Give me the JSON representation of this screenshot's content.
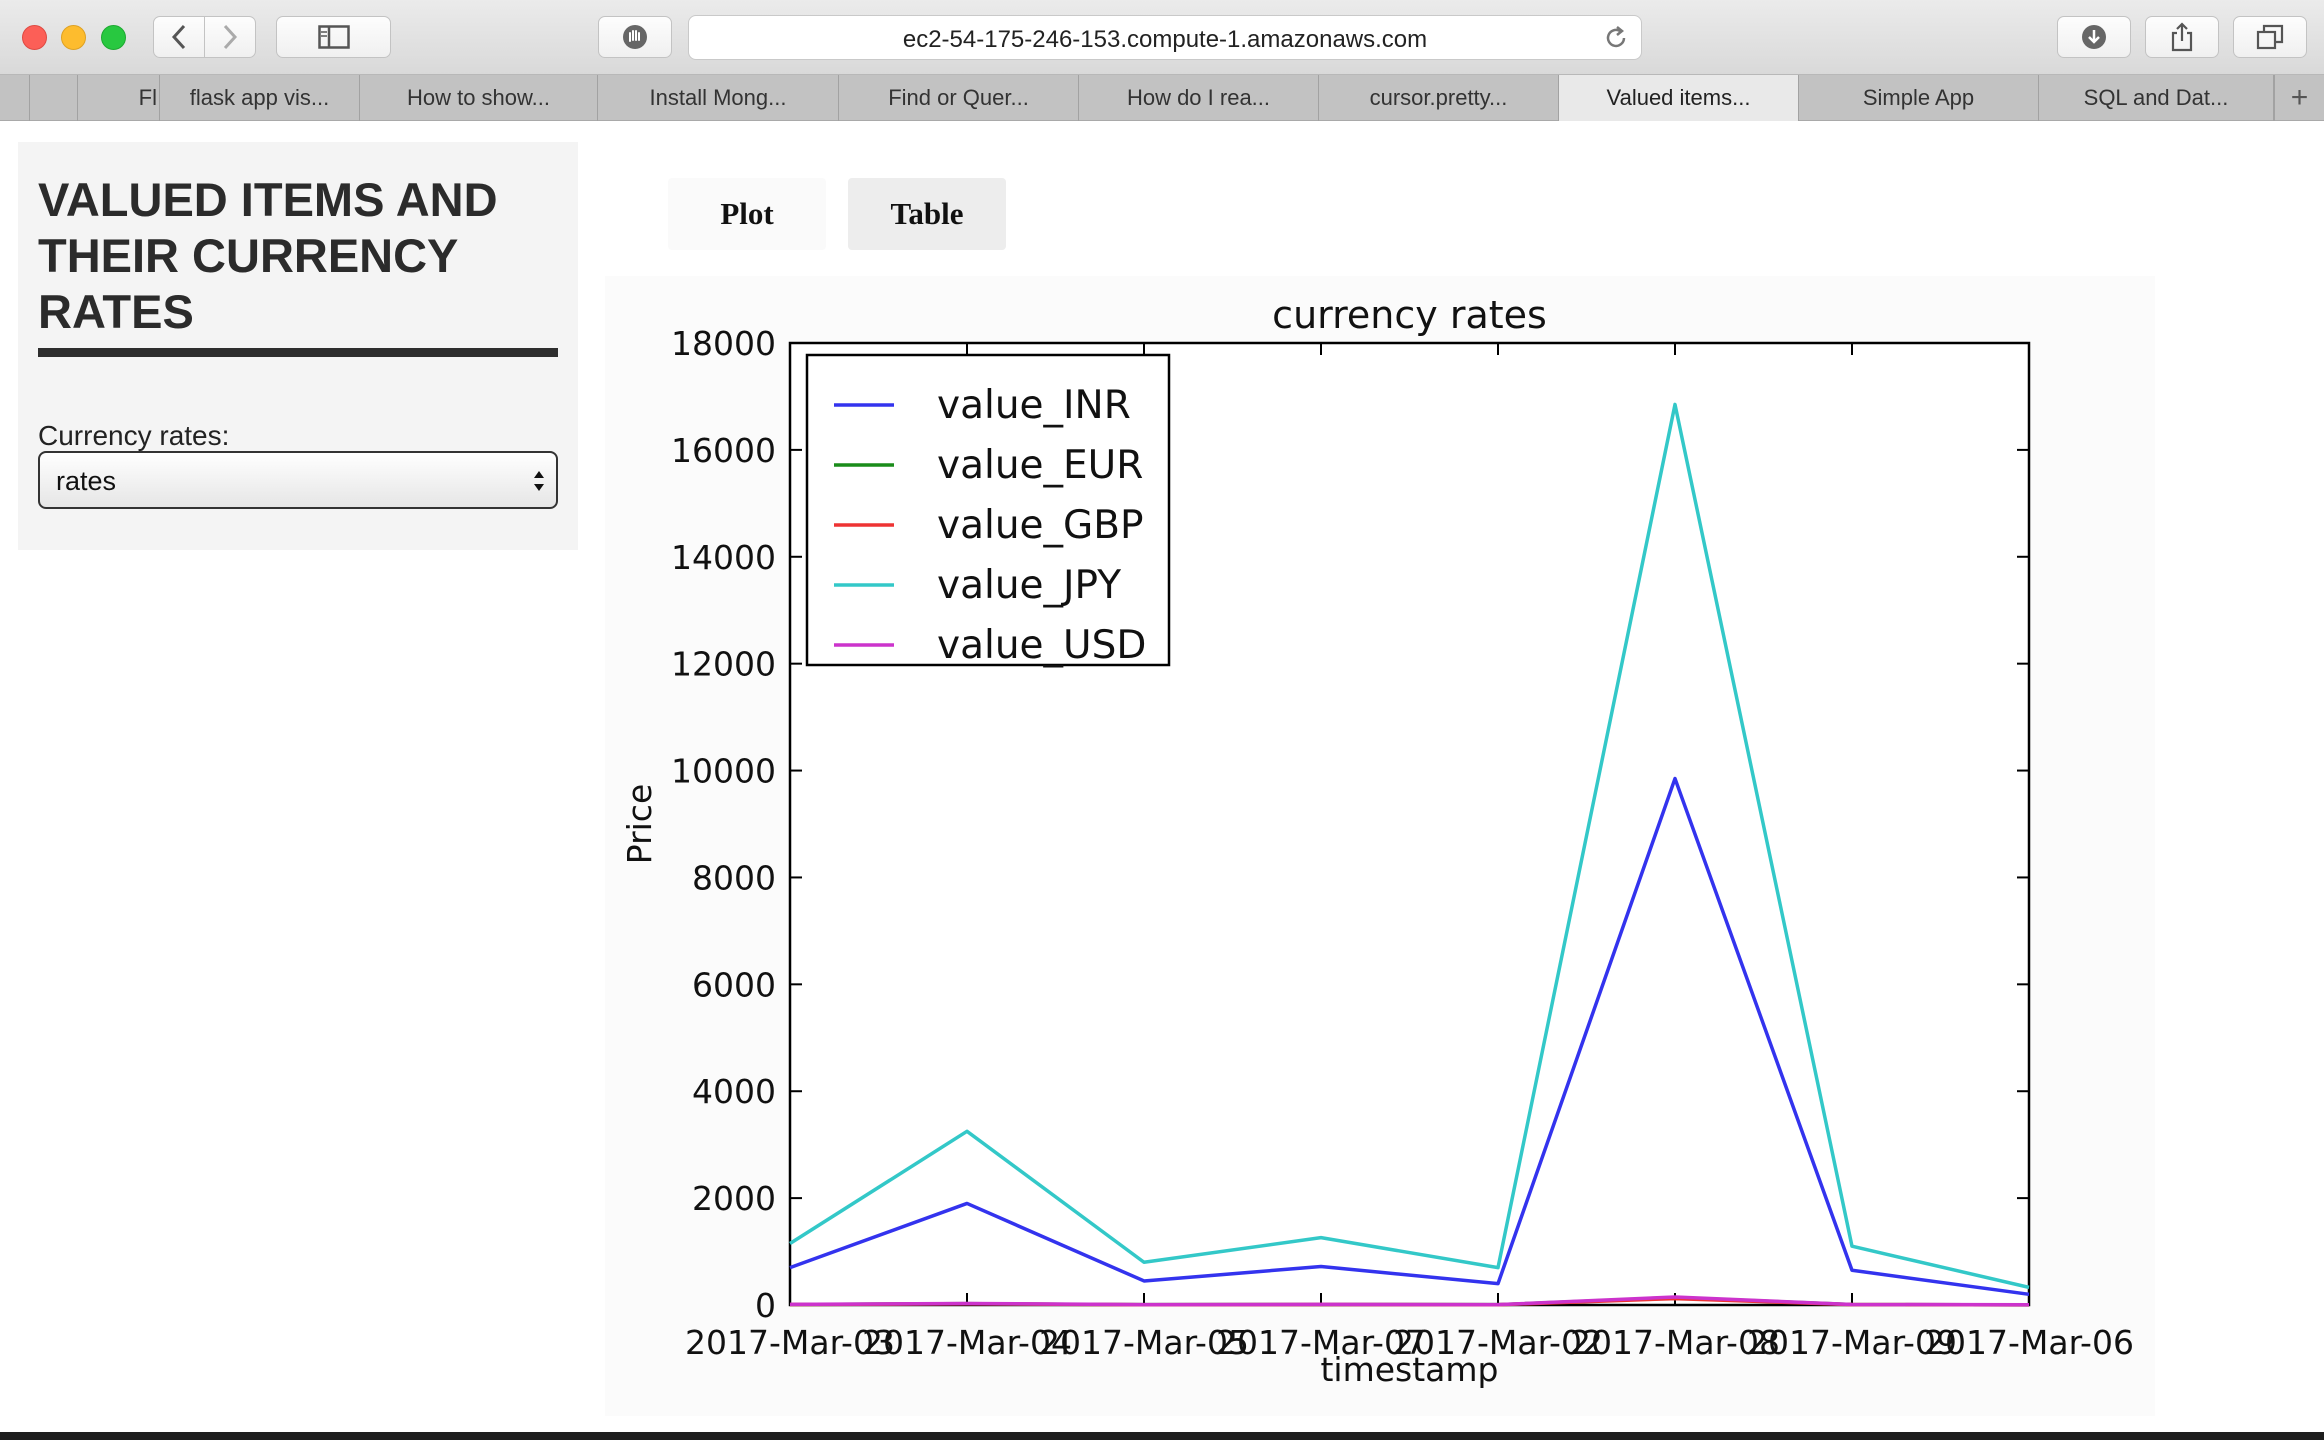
{
  "browser": {
    "url": "ec2-54-175-246-153.compute-1.amazonaws.com",
    "tabs": [
      {
        "label": "Fl"
      },
      {
        "label": "flask app vis..."
      },
      {
        "label": "How to show..."
      },
      {
        "label": "Install Mong..."
      },
      {
        "label": "Find or Quer..."
      },
      {
        "label": "How do I rea..."
      },
      {
        "label": "cursor.pretty..."
      },
      {
        "label": "Valued items..."
      },
      {
        "label": "Simple App"
      },
      {
        "label": "SQL and Dat..."
      }
    ],
    "active_tab_index": 7
  },
  "sidebar": {
    "title": "VALUED ITEMS AND THEIR CURRENCY RATES",
    "select_label": "Currency rates:",
    "select_value": "rates"
  },
  "view_tabs": {
    "plot": "Plot",
    "table": "Table"
  },
  "chart_data": {
    "type": "line",
    "title": "currency rates",
    "xlabel": "timestamp",
    "ylabel": "Price",
    "categories": [
      "2017-Mar-03",
      "2017-Mar-04",
      "2017-Mar-05",
      "2017-Mar-07",
      "2017-Mar-02",
      "2017-Mar-08",
      "2017-Mar-09",
      "2017-Mar-06"
    ],
    "ylim": [
      0,
      18000
    ],
    "yticks": [
      0,
      2000,
      4000,
      6000,
      8000,
      10000,
      12000,
      14000,
      16000,
      18000
    ],
    "legend_position": "top-left",
    "grid": false,
    "series": [
      {
        "name": "value_INR",
        "color": "#3333ee",
        "values": [
          700,
          1900,
          450,
          720,
          400,
          9850,
          650,
          200
        ]
      },
      {
        "name": "value_EUR",
        "color": "#1a8c1a",
        "values": [
          10,
          25,
          6,
          10,
          6,
          140,
          9,
          3
        ]
      },
      {
        "name": "value_GBP",
        "color": "#ee3333",
        "values": [
          9,
          23,
          5,
          9,
          5,
          120,
          8,
          3
        ]
      },
      {
        "name": "value_JPY",
        "color": "#33c8c8",
        "values": [
          1150,
          3250,
          800,
          1260,
          700,
          16850,
          1100,
          330
        ]
      },
      {
        "name": "value_USD",
        "color": "#cc33cc",
        "values": [
          11,
          29,
          7,
          11,
          7,
          150,
          10,
          4
        ]
      }
    ]
  }
}
